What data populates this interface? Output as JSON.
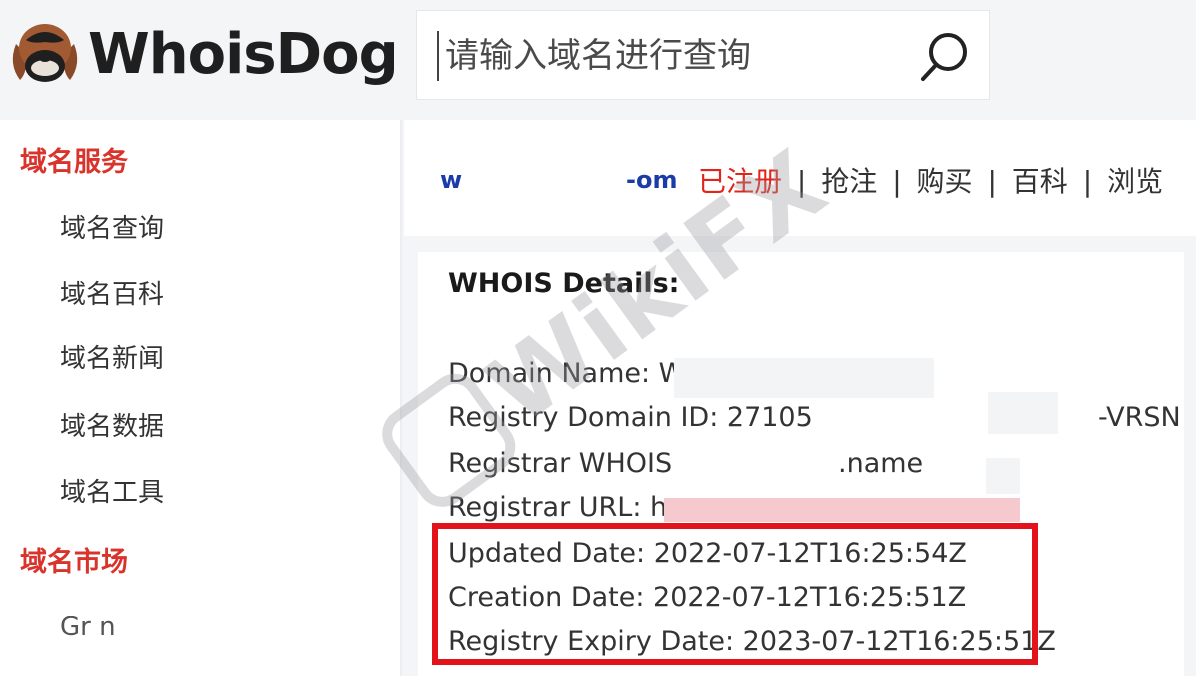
{
  "header": {
    "logo_text": "WhoisDog",
    "search_placeholder": "请输入域名进行查询",
    "search_icon": "search-icon"
  },
  "sidebar": {
    "sections": [
      {
        "title": "域名服务",
        "items": [
          "域名查询",
          "域名百科",
          "域名新闻",
          "域名数据",
          "域名工具"
        ]
      },
      {
        "title": "域名市场",
        "items": []
      }
    ],
    "cut_item": "Gr         n"
  },
  "domain_bar": {
    "name_start": "w",
    "name_end": "-om",
    "status": "已注册",
    "links": [
      "抢注",
      "购买",
      "百科",
      "浏览"
    ],
    "separator": "|"
  },
  "whois": {
    "title": "WHOIS Details:",
    "lines": [
      "Domain Name: WIN",
      "Registry Domain ID: 27105",
      "-VRSN",
      "Registrar WHOIS",
      ".name",
      "Registrar URL: h",
      "Updated Date: 2022-07-12T16:25:54Z",
      "Creation Date: 2022-07-12T16:25:51Z",
      "Registry Expiry Date: 2023-07-12T16:25:51Z"
    ]
  },
  "watermark": {
    "text": "WikiFX"
  },
  "colors": {
    "accent_red": "#d9342b",
    "status_red": "#e1251b",
    "highlight_red": "#e3131b",
    "link_blue": "#1a3ba8"
  }
}
